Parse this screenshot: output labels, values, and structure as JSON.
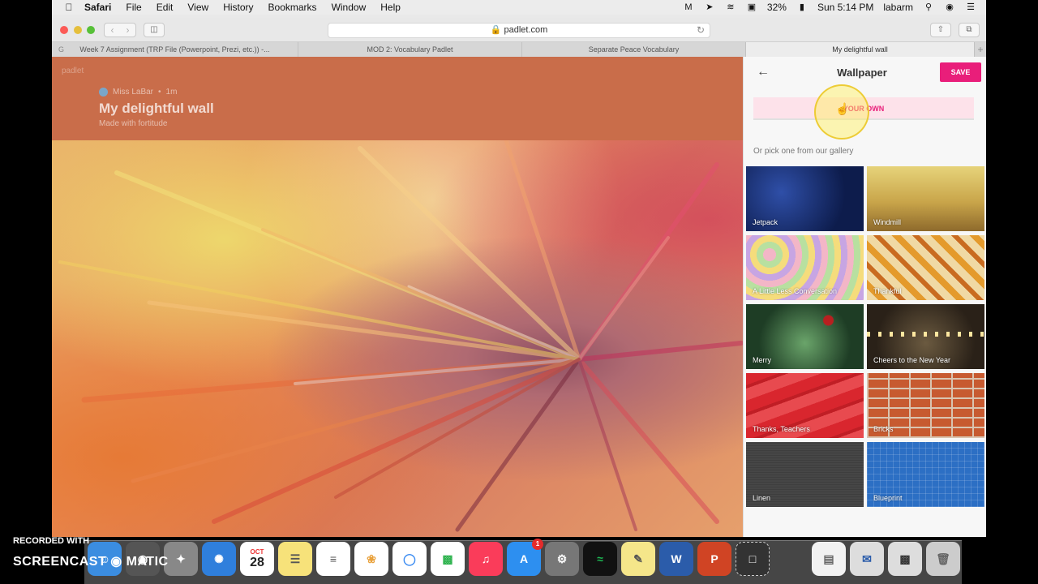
{
  "menubar": {
    "apple_icon": "apple-icon",
    "app": "Safari",
    "items": [
      "File",
      "Edit",
      "View",
      "History",
      "Bookmarks",
      "Window",
      "Help"
    ],
    "battery": "32%",
    "clock": "Sun 5:14 PM",
    "user": "labarm"
  },
  "browser": {
    "url": "padlet.com",
    "tabs": [
      {
        "label": "Week 7 Assignment (TRP File (Powerpoint, Prezi, etc.)) -..."
      },
      {
        "label": "MOD 2: Vocabulary Padlet"
      },
      {
        "label": "Separate Peace Vocabulary"
      },
      {
        "label": "My delightful wall"
      }
    ]
  },
  "padlet": {
    "logo": "padlet",
    "author": "Miss LaBar",
    "time": "1m",
    "title": "My delightful wall",
    "subtitle": "Made with fortitude"
  },
  "panel": {
    "title": "Wallpaper",
    "save_label": "SAVE",
    "add_own_label": "YOUR OWN",
    "gallery_label": "Or pick one from our gallery",
    "wallpapers": [
      {
        "label": "Jetpack"
      },
      {
        "label": "Windmill"
      },
      {
        "label": "A Little Less Conversation"
      },
      {
        "label": "Thankful"
      },
      {
        "label": "Merry"
      },
      {
        "label": "Cheers to the New Year"
      },
      {
        "label": "Thanks, Teachers"
      },
      {
        "label": "Bricks"
      },
      {
        "label": "Linen"
      },
      {
        "label": "Blueprint"
      }
    ]
  },
  "dock": {
    "calendar_month": "OCT",
    "calendar_day": "28",
    "appstore_badge": "1"
  },
  "watermark": {
    "line1": "RECORDED WITH",
    "line2": "SCREENCAST",
    "line3": "MATIC"
  }
}
